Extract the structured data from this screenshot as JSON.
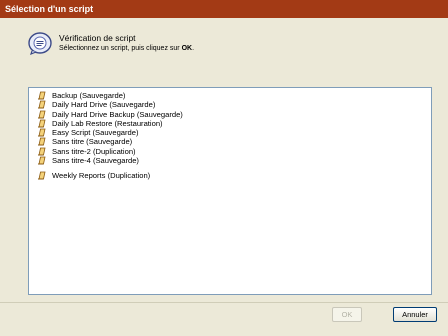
{
  "window": {
    "title": "Sélection d'un script"
  },
  "header": {
    "title": "Vérification de script",
    "subtitle_prefix": "Sélectionnez un script, puis cliquez sur",
    "subtitle_emphasis": "OK",
    "subtitle_suffix": ".",
    "icon": "script-check-icon"
  },
  "scripts": [
    {
      "label": "Backup (Sauvegarde)",
      "icon": "script-icon"
    },
    {
      "label": "Daily Hard Drive (Sauvegarde)",
      "icon": "script-icon"
    },
    {
      "label": "Daily Hard Drive Backup (Sauvegarde)",
      "icon": "script-icon"
    },
    {
      "label": "Daily Lab Restore (Restauration)",
      "icon": "script-icon"
    },
    {
      "label": "Easy Script (Sauvegarde)",
      "icon": "script-icon"
    },
    {
      "label": "Sans titre (Sauvegarde)",
      "icon": "script-icon"
    },
    {
      "label": "Sans titre-2 (Duplication)",
      "icon": "script-icon"
    },
    {
      "label": "Sans titre-4 (Sauvegarde)",
      "icon": "script-icon"
    },
    {
      "label": "Weekly Reports (Duplication)",
      "icon": "script-icon"
    }
  ],
  "buttons": {
    "ok_label": "OK",
    "cancel_label": "Annuler",
    "ok_enabled": false
  },
  "colors": {
    "titlebar": "#a33a15",
    "window_bg": "#ece9d8",
    "list_border": "#7f9db9"
  }
}
